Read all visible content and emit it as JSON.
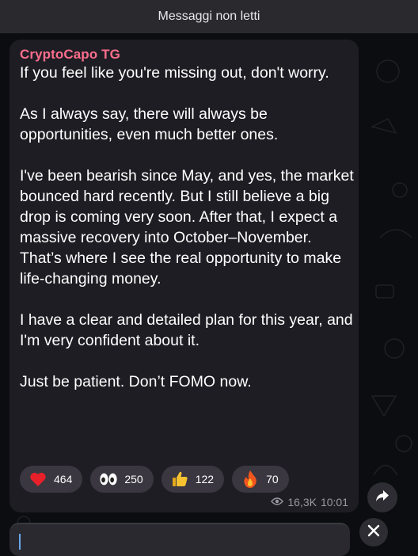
{
  "header": {
    "unread_label": "Messaggi non letti"
  },
  "message": {
    "sender": "CryptoCapo TG",
    "paragraphs": [
      "If you feel like you're missing out, don't worry.",
      "As I always say, there will always be opportunities, even much better ones.",
      "I've been bearish since May, and yes, the market bounced hard recently. But I still believe a big drop is coming very soon. After that, I expect a massive recovery into October–November.",
      "That’s where I see the real opportunity to make life-changing money.",
      "I have a clear and detailed plan for this year, and I'm very confident about it.",
      "Just be patient. Don’t FOMO now."
    ],
    "reactions": [
      {
        "emoji": "heart-icon",
        "count": "464"
      },
      {
        "emoji": "eyes-icon",
        "count": "250"
      },
      {
        "emoji": "thumbs-up-icon",
        "count": "122"
      },
      {
        "emoji": "fire-icon",
        "count": "70"
      }
    ],
    "views": "16,3K",
    "time": "10:01"
  },
  "colors": {
    "sender": "#fa6e8c",
    "bubble": "#1f1d24",
    "reaction_bg": "#3a3740"
  }
}
